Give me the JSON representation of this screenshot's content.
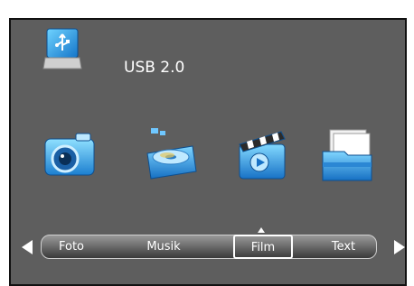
{
  "source": {
    "label": "USB 2.0",
    "icon": "usb-drive-icon"
  },
  "apps": [
    {
      "icon": "camera-icon",
      "name": "foto"
    },
    {
      "icon": "music-disc-icon",
      "name": "musik"
    },
    {
      "icon": "film-clapper-icon",
      "name": "film"
    },
    {
      "icon": "folder-icon",
      "name": "text"
    }
  ],
  "menu": {
    "items": [
      "Foto",
      "Musik",
      "Film",
      "Text"
    ],
    "selected": "Film"
  },
  "nav": {
    "left": "triangle-left-icon",
    "right": "triangle-right-icon"
  },
  "colors": {
    "background": "#5e5e5e",
    "accent": "#2fa6e6",
    "text": "#ffffff"
  }
}
